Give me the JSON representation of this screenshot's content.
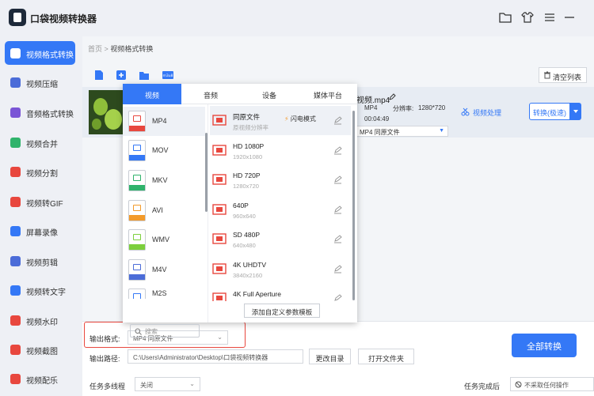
{
  "app": {
    "title": "口袋视频转换器"
  },
  "sidebar": {
    "items": [
      {
        "label": "视频格式转换",
        "icon": "video-convert-icon",
        "color": "#3478f6"
      },
      {
        "label": "视频压缩",
        "icon": "compress-icon",
        "color": "#4b6cd8"
      },
      {
        "label": "音频格式转换",
        "icon": "audio-convert-icon",
        "color": "#7a55d6"
      },
      {
        "label": "视频合并",
        "icon": "merge-icon",
        "color": "#2fb36b"
      },
      {
        "label": "视频分割",
        "icon": "split-icon",
        "color": "#e8473e"
      },
      {
        "label": "视频转GIF",
        "icon": "gif-icon",
        "color": "#e8473e"
      },
      {
        "label": "屏幕录像",
        "icon": "record-icon",
        "color": "#3478f6"
      },
      {
        "label": "视频剪辑",
        "icon": "edit-icon",
        "color": "#4b6cd8"
      },
      {
        "label": "视频转文字",
        "icon": "text-icon",
        "color": "#3478f6"
      },
      {
        "label": "视频水印",
        "icon": "watermark-icon",
        "color": "#e8473e"
      },
      {
        "label": "视频截图",
        "icon": "screenshot-icon",
        "color": "#e8473e"
      },
      {
        "label": "视频配乐",
        "icon": "music-icon",
        "color": "#e8473e"
      }
    ]
  },
  "breadcrumb": {
    "home": "首页",
    "sep": ">",
    "current": "视频格式转换"
  },
  "toolbar": {
    "clear_label": "清空列表"
  },
  "file": {
    "name": "视频.mp4",
    "format": "MP4",
    "res_label": "分辨率:",
    "resolution": "1280*720",
    "duration": "00:04:49",
    "target": "MP4 同原文件",
    "process_label": "视频处理",
    "convert_label": "转换(极速)"
  },
  "popup": {
    "tabs": [
      "视频",
      "音频",
      "设备",
      "媒体平台"
    ],
    "formats": [
      {
        "label": "MP4",
        "color": "#e8473e"
      },
      {
        "label": "MOV",
        "color": "#3478f6"
      },
      {
        "label": "MKV",
        "color": "#2fb36b"
      },
      {
        "label": "AVI",
        "color": "#f39a2a"
      },
      {
        "label": "WMV",
        "color": "#7ccf3c"
      },
      {
        "label": "M4V",
        "color": "#4b6cd8"
      },
      {
        "label": "M2S",
        "color": "#3478f6"
      }
    ],
    "search_placeholder": "搜索",
    "flash_mode": "闪电模式",
    "presets": [
      {
        "name": "同原文件",
        "sub": "原视频分辨率"
      },
      {
        "name": "HD 1080P",
        "sub": "1920x1080"
      },
      {
        "name": "HD 720P",
        "sub": "1280x720"
      },
      {
        "name": "640P",
        "sub": "960x640"
      },
      {
        "name": "SD 480P",
        "sub": "640x480"
      },
      {
        "name": "4K UHDTV",
        "sub": "3840x2160"
      },
      {
        "name": "4K Full Aperture",
        "sub": ""
      }
    ],
    "custom_label": "添加自定义参数模板"
  },
  "bottom": {
    "output_format_label": "输出格式:",
    "output_format_value": "MP4 同原文件",
    "output_path_label": "输出路径:",
    "output_path_value": "C:\\Users\\Administrator\\Desktop\\口袋视频转换器",
    "change_dir_label": "更改目录",
    "open_folder_label": "打开文件夹",
    "multithread_label": "任务多线程",
    "multithread_value": "关闭",
    "after_done_label": "任务完成后",
    "after_done_value": "不采取任何操作",
    "all_convert_label": "全部转换"
  }
}
